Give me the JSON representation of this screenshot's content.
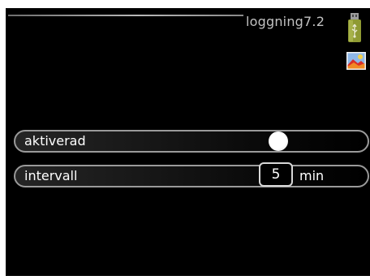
{
  "header": {
    "title": "loggning7.2",
    "icons": [
      "usb-drive-icon",
      "image-icon"
    ]
  },
  "settings": {
    "rows": [
      {
        "label": "aktiverad",
        "control": "toggle",
        "state": "on"
      },
      {
        "label": "intervall",
        "control": "stepper",
        "value": "5",
        "unit": "min"
      }
    ]
  },
  "colors": {
    "background": "#000000",
    "text": "#ffffff",
    "row_border": "#9a9a9a",
    "usb_icon": "#9aa63a"
  }
}
